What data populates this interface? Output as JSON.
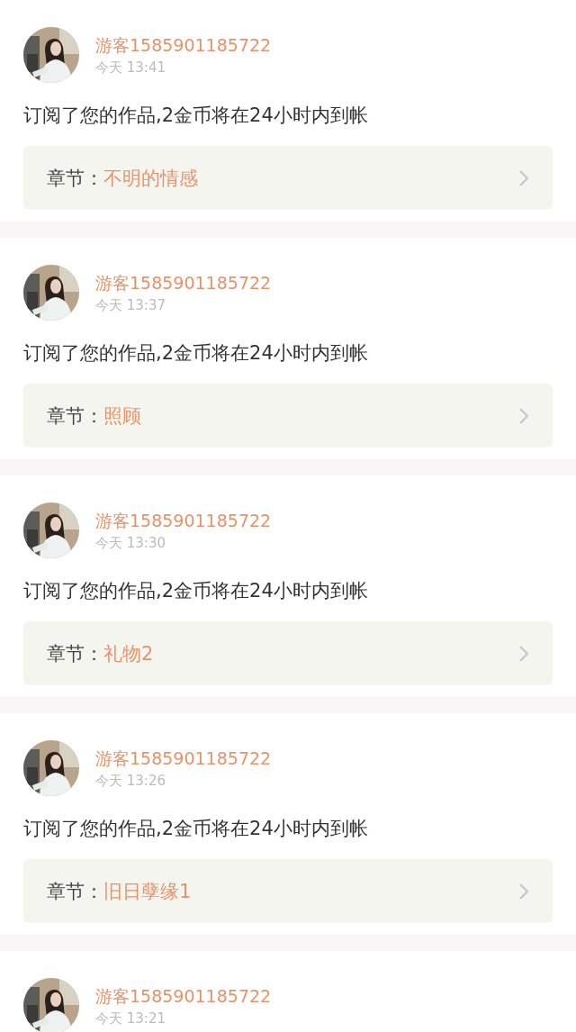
{
  "notifications": [
    {
      "user": "游客1585901185722",
      "time": "今天 13:41",
      "message": "订阅了您的作品,2金币将在24小时内到帐",
      "chapter_label": "章节：",
      "chapter": "不明的情感"
    },
    {
      "user": "游客1585901185722",
      "time": "今天 13:37",
      "message": "订阅了您的作品,2金币将在24小时内到帐",
      "chapter_label": "章节：",
      "chapter": "照顾"
    },
    {
      "user": "游客1585901185722",
      "time": "今天 13:30",
      "message": "订阅了您的作品,2金币将在24小时内到帐",
      "chapter_label": "章节：",
      "chapter": "礼物2"
    },
    {
      "user": "游客1585901185722",
      "time": "今天 13:26",
      "message": "订阅了您的作品,2金币将在24小时内到帐",
      "chapter_label": "章节：",
      "chapter": "旧日孽缘1"
    },
    {
      "user": "游客1585901185722",
      "time": "今天 13:21"
    }
  ]
}
